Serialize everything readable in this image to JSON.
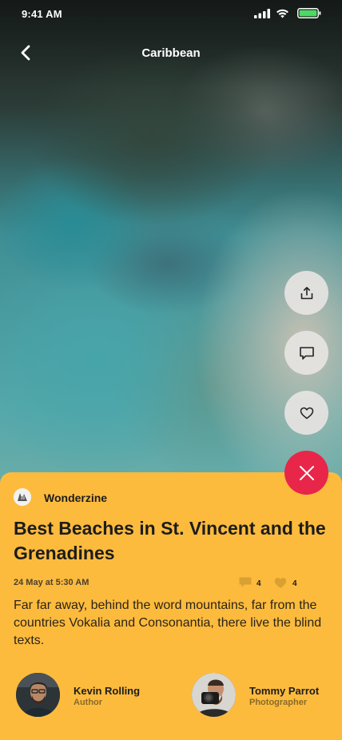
{
  "status_bar": {
    "time": "9:41 AM"
  },
  "nav": {
    "title": "Caribbean"
  },
  "actions": [
    "share-icon",
    "comment-icon",
    "heart-icon",
    "close-icon"
  ],
  "article": {
    "publisher": "Wonderzine",
    "title": "Best Beaches in St. Vincent and the Grenadines",
    "date": "24 May at 5:30 AM",
    "comments": "4",
    "likes": "4",
    "excerpt": "Far far away, behind the word mountains, far from the countries Vokalia and Consonantia, there live the blind texts."
  },
  "credits": {
    "author": {
      "name": "Kevin Rolling",
      "role": "Author"
    },
    "photographer": {
      "name": "Tommy Parrot",
      "role": "Photographer"
    }
  },
  "colors": {
    "card": "#fdbb3d",
    "close_button": "#e8264a",
    "action_button": "#e6e4e2"
  }
}
